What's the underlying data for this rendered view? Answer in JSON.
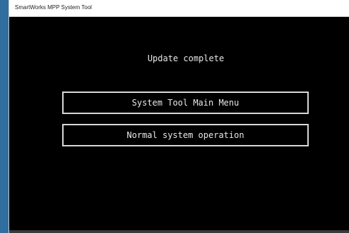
{
  "window": {
    "title": "SmartWorks MPP System Tool"
  },
  "screen": {
    "status_text": "Update complete",
    "buttons": [
      {
        "label": "System Tool Main Menu"
      },
      {
        "label": "Normal system operation"
      }
    ]
  },
  "colors": {
    "background": "#000000",
    "text": "#e8e8e8",
    "button_border": "#d8d8d8",
    "titlebar": "#ffffff"
  }
}
